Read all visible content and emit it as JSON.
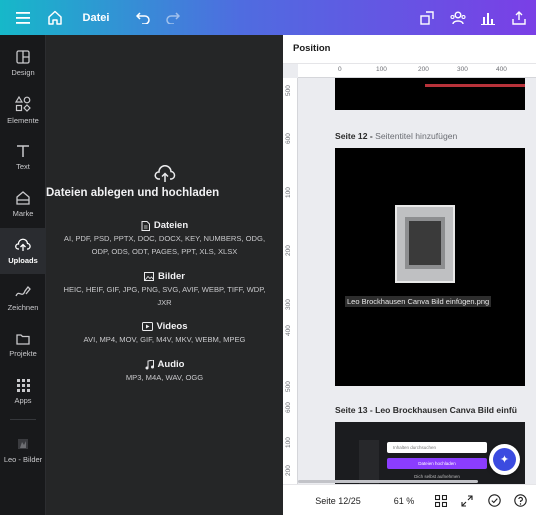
{
  "topbar": {
    "file_label": "Datei"
  },
  "rail": {
    "items": [
      {
        "label": "Design",
        "icon": "layout-icon"
      },
      {
        "label": "Elemente",
        "icon": "shapes-icon"
      },
      {
        "label": "Text",
        "icon": "text-icon"
      },
      {
        "label": "Marke",
        "icon": "brand-icon"
      },
      {
        "label": "Uploads",
        "icon": "cloud-upload-icon"
      },
      {
        "label": "Zeichnen",
        "icon": "draw-icon"
      },
      {
        "label": "Projekte",
        "icon": "folder-icon"
      },
      {
        "label": "Apps",
        "icon": "apps-grid-icon"
      },
      {
        "label": "Leo - Bilder",
        "icon": "folder-thumbnail-icon"
      }
    ],
    "active": "Uploads"
  },
  "upload_panel": {
    "title": "Dateien ablegen und hochladen",
    "sections": [
      {
        "heading": "Dateien",
        "icon": "file-icon",
        "formats": "AI, PDF, PSD, PPTX, DOC, DOCX, KEY, NUMBERS, ODG, ODP, ODS, ODT, PAGES, PPT, XLS, XLSX"
      },
      {
        "heading": "Bilder",
        "icon": "image-icon",
        "formats": "HEIC, HEIF, GIF, JPG, PNG, SVG, AVIF, WEBP, TIFF, WDP, JXR"
      },
      {
        "heading": "Videos",
        "icon": "video-icon",
        "formats": "AVI, MP4, MOV, GIF, M4V, MKV, WEBM, MPEG"
      },
      {
        "heading": "Audio",
        "icon": "music-icon",
        "formats": "MP3, M4A, WAV, OGG"
      }
    ]
  },
  "right_panel": {
    "header": "Position",
    "ruler_top": [
      "0",
      "100",
      "200",
      "300",
      "400"
    ],
    "ruler_left": [
      "500",
      "600",
      "100",
      "200",
      "300",
      "400",
      "500",
      "600",
      "100",
      "200"
    ],
    "page12": {
      "label": "Seite 12 - ",
      "sub": "Seitentitel hinzufügen",
      "image_caption": "Leo Brockhausen Canva Bild einfügen.png"
    },
    "page13": {
      "label": "Seite 13 - Leo Brockhausen Canva Bild einfü"
    },
    "thumb": {
      "search": "Inhalten durchsuchen",
      "upload_btn": "Dateien hochladen",
      "record": "Dich selbst aufnehmen"
    }
  },
  "bottom_bar": {
    "page_indicator": "Seite 12/25",
    "zoom": "61 %"
  },
  "colors": {
    "accent_purple": "#8b3dff",
    "panel_bg": "#252627",
    "rail_bg": "#18191b"
  }
}
